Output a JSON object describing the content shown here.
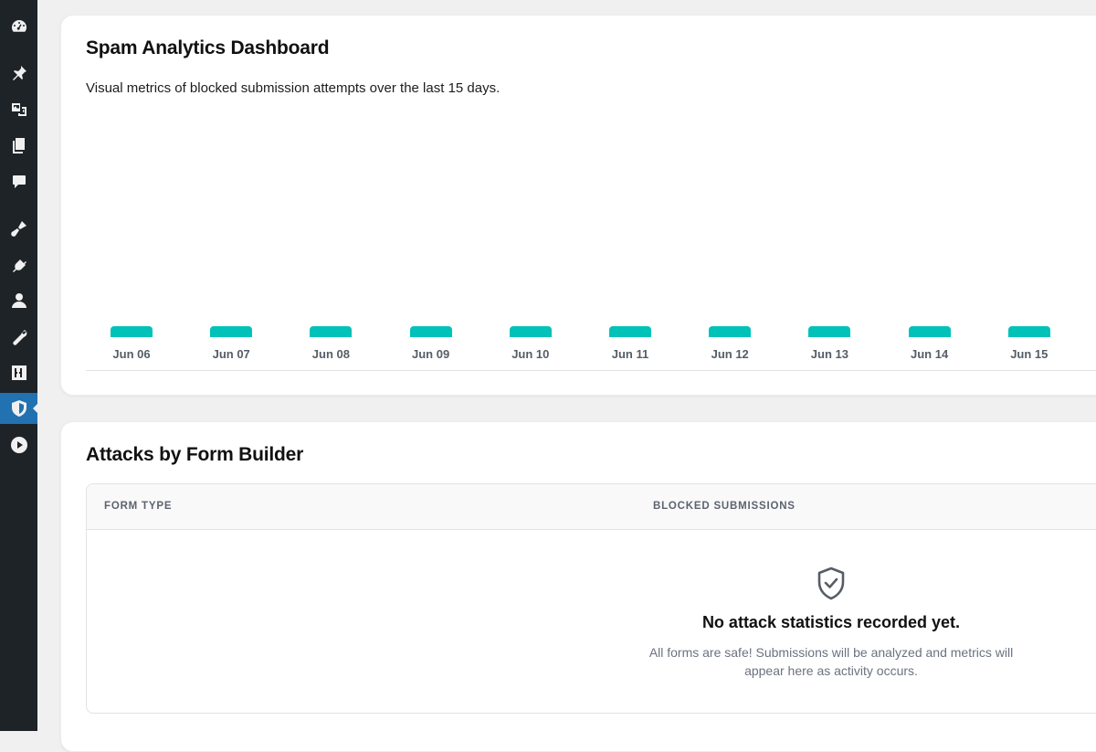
{
  "sidebar": {
    "icons": [
      "dashboard-icon",
      "pin-icon",
      "media-icon",
      "pages-icon",
      "comments-icon",
      "appearance-icon",
      "plugins-icon",
      "users-icon",
      "tools-icon",
      "settings-icon",
      "shield-icon",
      "play-icon"
    ],
    "active": "shield-icon",
    "colors": {
      "background": "#1d2327",
      "active": "#2271b1"
    }
  },
  "analytics": {
    "title": "Spam Analytics Dashboard",
    "subtitle": "Visual metrics of blocked submission attempts over the last 15 days."
  },
  "chart_data": {
    "type": "bar",
    "categories": [
      "Jun 06",
      "Jun 07",
      "Jun 08",
      "Jun 09",
      "Jun 10",
      "Jun 11",
      "Jun 12",
      "Jun 13",
      "Jun 14",
      "Jun 15"
    ],
    "values": [
      0,
      0,
      0,
      0,
      0,
      0,
      0,
      0,
      0,
      0
    ],
    "color": "#00c2b8",
    "title": "",
    "xlabel": "",
    "ylabel": "",
    "grid": false
  },
  "attacks": {
    "title": "Attacks by Form Builder",
    "columns": [
      "FORM TYPE",
      "BLOCKED SUBMISSIONS"
    ],
    "empty_title": "No attack statistics recorded yet.",
    "empty_text": "All forms are safe! Submissions will be analyzed and metrics will appear here as activity occurs."
  }
}
